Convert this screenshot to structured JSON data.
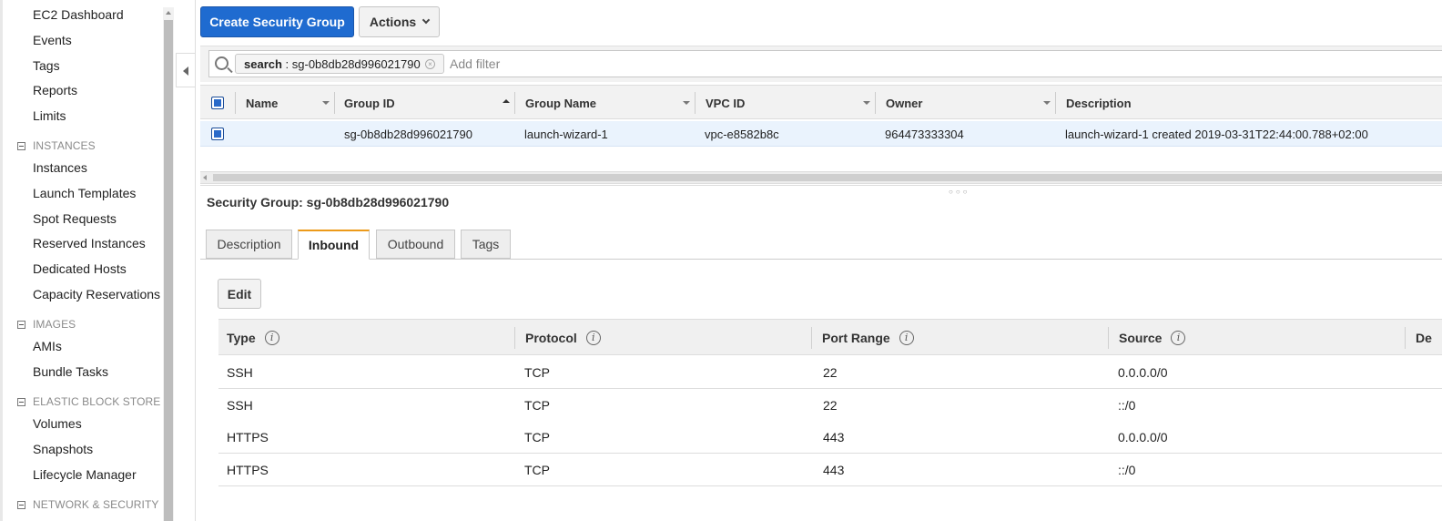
{
  "sidebar": {
    "items_top": [
      "EC2 Dashboard",
      "Events",
      "Tags",
      "Reports",
      "Limits"
    ],
    "sections": [
      {
        "label": "INSTANCES",
        "items": [
          "Instances",
          "Launch Templates",
          "Spot Requests",
          "Reserved Instances",
          "Dedicated Hosts",
          "Capacity Reservations"
        ]
      },
      {
        "label": "IMAGES",
        "items": [
          "AMIs",
          "Bundle Tasks"
        ]
      },
      {
        "label": "ELASTIC BLOCK STORE",
        "items": [
          "Volumes",
          "Snapshots",
          "Lifecycle Manager"
        ]
      },
      {
        "label": "NETWORK & SECURITY",
        "items": []
      }
    ]
  },
  "toolbar": {
    "create_label": "Create Security Group",
    "actions_label": "Actions"
  },
  "filter": {
    "token_key": "search",
    "token_sep": " : ",
    "token_value": "sg-0b8db28d996021790",
    "placeholder": "Add filter",
    "close_glyph": "×"
  },
  "groups_table": {
    "columns": [
      "Name",
      "Group ID",
      "Group Name",
      "VPC ID",
      "Owner",
      "Description"
    ],
    "rows": [
      {
        "name": "",
        "group_id": "sg-0b8db28d996021790",
        "group_name": "launch-wizard-1",
        "vpc_id": "vpc-e8582b8c",
        "owner": "964473333304",
        "description": "launch-wizard-1 created 2019-03-31T22:44:00.788+02:00",
        "selected": true
      }
    ]
  },
  "detail": {
    "title": "Security Group: sg-0b8db28d996021790",
    "tabs": [
      "Description",
      "Inbound",
      "Outbound",
      "Tags"
    ],
    "active_tab": "Inbound",
    "edit_label": "Edit",
    "rules_columns": [
      "Type",
      "Protocol",
      "Port Range",
      "Source",
      "De"
    ],
    "info_glyph": "i",
    "rules": [
      {
        "type": "SSH",
        "protocol": "TCP",
        "port_range": "22",
        "source": "0.0.0.0/0"
      },
      {
        "type": "SSH",
        "protocol": "TCP",
        "port_range": "22",
        "source": "::/0"
      },
      {
        "type": "HTTPS",
        "protocol": "TCP",
        "port_range": "443",
        "source": "0.0.0.0/0"
      },
      {
        "type": "HTTPS",
        "protocol": "TCP",
        "port_range": "443",
        "source": "::/0"
      }
    ]
  },
  "colors": {
    "primary_button": "#1f6bd0",
    "selected_row": "#eaf3fd",
    "active_tab_accent": "#ec9a1a"
  }
}
